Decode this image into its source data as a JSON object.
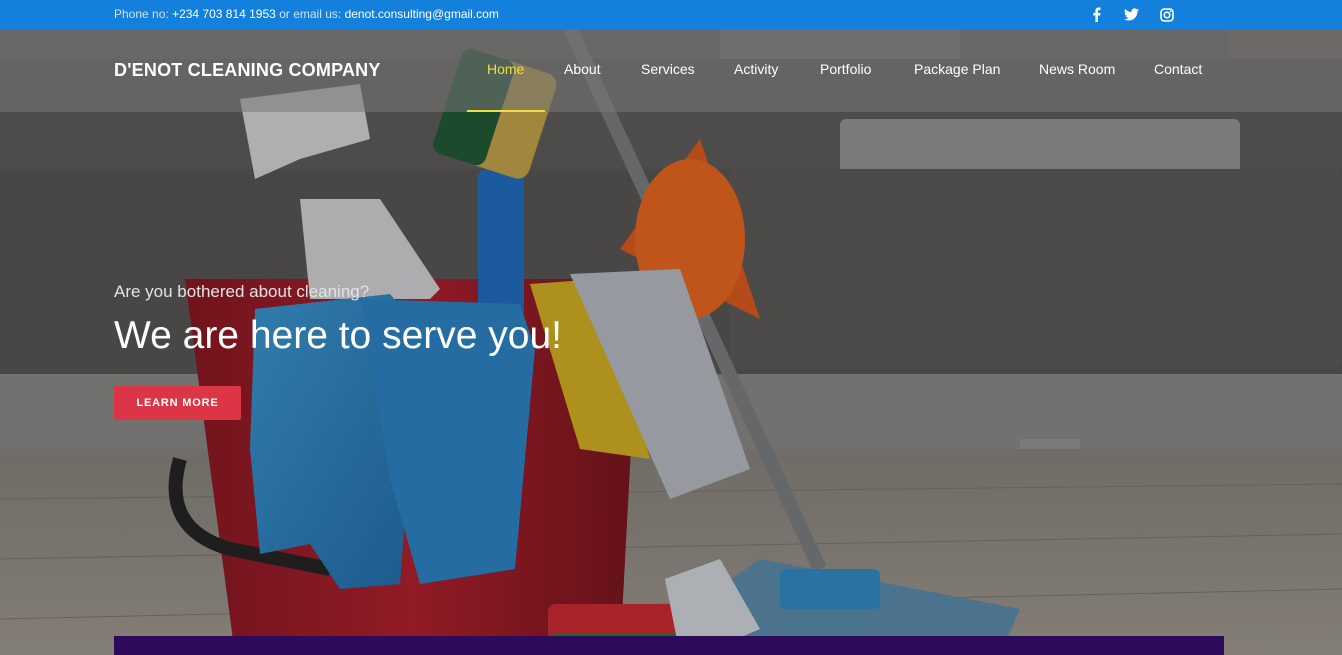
{
  "topbar": {
    "phone_prefix": "Phone no:",
    "phone": "+234 703 814 1953",
    "email_prefix": "or email us:",
    "email": "denot.consulting@gmail.com",
    "social_icons": [
      "facebook-icon",
      "twitter-icon",
      "instagram-icon"
    ]
  },
  "header": {
    "brand": "D'ENOT CLEANING COMPANY",
    "nav": [
      {
        "label": "Home",
        "active": true
      },
      {
        "label": "About",
        "active": false
      },
      {
        "label": "Services",
        "active": false
      },
      {
        "label": "Activity",
        "active": false
      },
      {
        "label": "Portfolio",
        "active": false
      },
      {
        "label": "Package Plan",
        "active": false
      },
      {
        "label": "News Room",
        "active": false
      },
      {
        "label": "Contact",
        "active": false
      }
    ]
  },
  "hero": {
    "tagline": "Are you bothered about cleaning?",
    "headline": "We are here to serve you!",
    "cta_label": "LEARN MORE"
  },
  "colors": {
    "topbar_bg": "#1380dc",
    "nav_active": "#f5dd3c",
    "cta_bg": "#dc3545",
    "footer_bar": "#2e0a5a"
  }
}
